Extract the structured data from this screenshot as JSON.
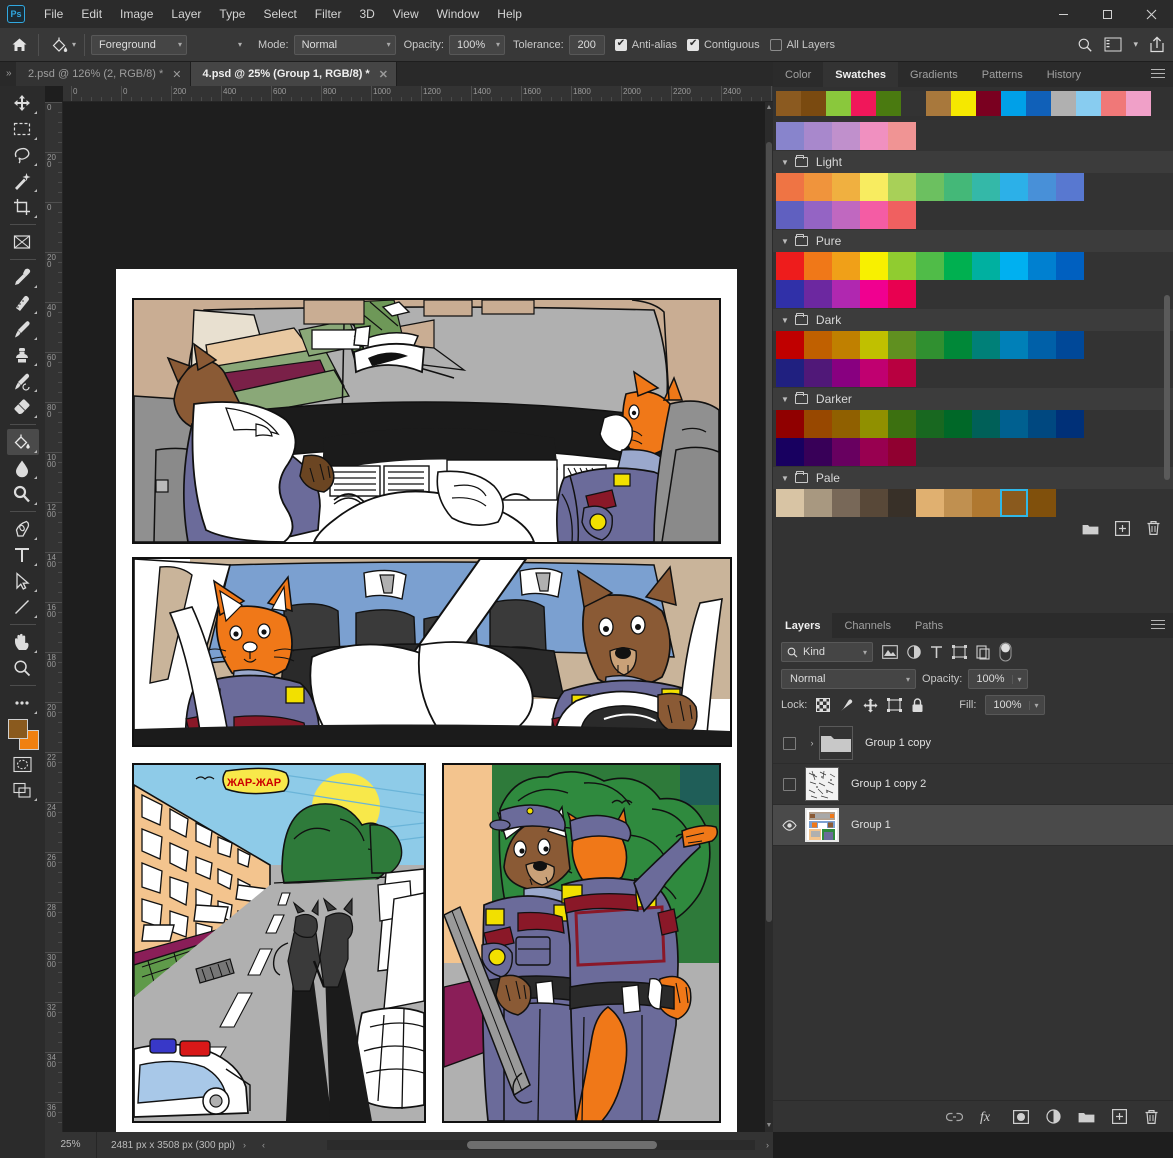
{
  "app": {
    "logo": "Ps",
    "menu": [
      "File",
      "Edit",
      "Image",
      "Layer",
      "Type",
      "Select",
      "Filter",
      "3D",
      "View",
      "Window",
      "Help"
    ],
    "window_controls": [
      "minimize",
      "maximize",
      "close"
    ]
  },
  "options_bar": {
    "home_icon": "home-icon",
    "tool_icon": "paint-bucket-icon",
    "fill_source": "Foreground",
    "mode_label": "Mode:",
    "mode_value": "Normal",
    "opacity_label": "Opacity:",
    "opacity_value": "100%",
    "tolerance_label": "Tolerance:",
    "tolerance_value": "200",
    "antialias_label": "Anti-alias",
    "antialias_checked": true,
    "contiguous_label": "Contiguous",
    "contiguous_checked": true,
    "all_layers_label": "All Layers",
    "all_layers_checked": false,
    "right_icons": [
      "search-icon",
      "workspace-icon",
      "chevron-down-icon",
      "share-icon"
    ]
  },
  "tabs": {
    "overflow_left": "»",
    "items": [
      {
        "label": "2.psd @ 126% (2, RGB/8) *",
        "active": false
      },
      {
        "label": "4.psd @ 25% (Group 1, RGB/8) *",
        "active": true
      }
    ],
    "overflow_right": "»"
  },
  "toolbar": {
    "tools": [
      {
        "name": "move-tool",
        "glyph": "move",
        "selected": false,
        "has_flyout": true
      },
      {
        "name": "rectangular-marquee-tool",
        "glyph": "marquee",
        "selected": false,
        "has_flyout": true
      },
      {
        "name": "lasso-tool",
        "glyph": "lasso",
        "selected": false,
        "has_flyout": true
      },
      {
        "name": "magic-wand-tool",
        "glyph": "wand",
        "selected": false,
        "has_flyout": true
      },
      {
        "name": "crop-tool",
        "glyph": "crop",
        "selected": false,
        "has_flyout": true
      },
      {
        "name": "frame-tool",
        "glyph": "frame",
        "selected": false,
        "has_flyout": false
      },
      {
        "name": "eyedropper-tool",
        "glyph": "eyedropper",
        "selected": false,
        "has_flyout": true
      },
      {
        "name": "spot-healing-brush-tool",
        "glyph": "heal",
        "selected": false,
        "has_flyout": true
      },
      {
        "name": "brush-tool",
        "glyph": "brush",
        "selected": false,
        "has_flyout": true
      },
      {
        "name": "clone-stamp-tool",
        "glyph": "stamp",
        "selected": false,
        "has_flyout": true
      },
      {
        "name": "history-brush-tool",
        "glyph": "historybrush",
        "selected": false,
        "has_flyout": true
      },
      {
        "name": "eraser-tool",
        "glyph": "eraser",
        "selected": false,
        "has_flyout": true
      },
      {
        "name": "paint-bucket-tool",
        "glyph": "bucket",
        "selected": true,
        "has_flyout": true
      },
      {
        "name": "blur-tool",
        "glyph": "blur",
        "selected": false,
        "has_flyout": true
      },
      {
        "name": "dodge-tool",
        "glyph": "dodge",
        "selected": false,
        "has_flyout": true
      },
      {
        "name": "pen-tool",
        "glyph": "pen",
        "selected": false,
        "has_flyout": true
      },
      {
        "name": "horizontal-type-tool",
        "glyph": "type",
        "selected": false,
        "has_flyout": true
      },
      {
        "name": "path-selection-tool",
        "glyph": "pathselect",
        "selected": false,
        "has_flyout": true
      },
      {
        "name": "line-tool",
        "glyph": "line",
        "selected": false,
        "has_flyout": true
      },
      {
        "name": "hand-tool",
        "glyph": "hand",
        "selected": false,
        "has_flyout": true
      },
      {
        "name": "zoom-tool",
        "glyph": "zoom",
        "selected": false,
        "has_flyout": false
      },
      {
        "name": "edit-toolbar-button",
        "glyph": "ellipsis",
        "selected": false,
        "has_flyout": true
      }
    ],
    "foreground_color": "#8a5a1e",
    "background_color": "#f08010",
    "quickmask_icon": "quick-mask-icon",
    "screenmode_icon": "screen-mode-icon"
  },
  "ruler": {
    "horizontal_labels": [
      "0",
      "0",
      "200",
      "400",
      "600",
      "800",
      "1000",
      "1200",
      "1400",
      "1600",
      "1800",
      "2000",
      "2200",
      "2400",
      "2"
    ],
    "vertical_labels": [
      "0",
      "200",
      "0",
      "200",
      "400",
      "600",
      "800",
      "1000",
      "1200",
      "1400",
      "1600",
      "1800",
      "2000",
      "2200",
      "2400",
      "2600",
      "2800",
      "3000",
      "3200",
      "3400",
      "3600"
    ]
  },
  "swatches_panel": {
    "tabs": [
      {
        "label": "Color",
        "active": false
      },
      {
        "label": "Swatches",
        "active": true
      },
      {
        "label": "Gradients",
        "active": false
      },
      {
        "label": "Patterns",
        "active": false
      },
      {
        "label": "History",
        "active": false
      }
    ],
    "recent": [
      "#8b5a20",
      "#7a4a10",
      "#8ac83c",
      "#f0175a",
      "#4a7a10",
      "#333333",
      "#a8783c",
      "#f5e800",
      "#7a0020",
      "#00a0e8",
      "#1060b8",
      "#b0b0b0",
      "#88ccf0",
      "#f07878",
      "#f0a0c8"
    ],
    "scroll_top_partial": [
      "#8884cc",
      "#a888cc",
      "#c090cc",
      "#f090c0",
      "#f09494"
    ],
    "groups": [
      {
        "name": "Light",
        "rows": [
          [
            "#ef7444",
            "#f0943c",
            "#f0b040",
            "#f8ec60",
            "#a8d058",
            "#6cc060",
            "#44b878",
            "#34b8a8",
            "#2cb0e8",
            "#4890d8",
            "#5878d0"
          ],
          [
            "#6060c0",
            "#9464c4",
            "#c068c0",
            "#f45ca4",
            "#f06060"
          ]
        ]
      },
      {
        "name": "Pure",
        "rows": [
          [
            "#ee1c1c",
            "#f07818",
            "#f0a018",
            "#f8f000",
            "#90cc30",
            "#50bc48",
            "#00b050",
            "#00b0a0",
            "#00b0f0",
            "#0080d0",
            "#0060c0"
          ],
          [
            "#3030a8",
            "#6c28a0",
            "#b028b0",
            "#f00090",
            "#e80050"
          ]
        ]
      },
      {
        "name": "Dark",
        "rows": [
          [
            "#c00000",
            "#c06000",
            "#c08000",
            "#c0c000",
            "#609020",
            "#309030",
            "#008838",
            "#008078",
            "#0080b8",
            "#0060a8",
            "#004898"
          ],
          [
            "#202080",
            "#501878",
            "#880080",
            "#c00070",
            "#b80040"
          ]
        ]
      },
      {
        "name": "Darker",
        "rows": [
          [
            "#900000",
            "#984800",
            "#906000",
            "#909000",
            "#3c7010",
            "#186820",
            "#006828",
            "#006058",
            "#006090",
            "#004880",
            "#003078"
          ],
          [
            "#180060",
            "#380058",
            "#680060",
            "#980050",
            "#900030"
          ]
        ]
      },
      {
        "name": "Pale",
        "rows": [
          [
            "#d8c4a4",
            "#a89880",
            "#786858",
            "#584838",
            "#383028",
            "#e0b070",
            "#c09050",
            "#b07830",
            "#8a5a1e",
            "#80500c"
          ]
        ]
      }
    ],
    "selected_swatch": "#8a5a1e",
    "footer_icons": [
      "new-group-icon",
      "new-swatch-icon",
      "delete-swatch-icon"
    ]
  },
  "layers_panel": {
    "tabs": [
      {
        "label": "Layers",
        "active": true
      },
      {
        "label": "Channels",
        "active": false
      },
      {
        "label": "Paths",
        "active": false
      }
    ],
    "filter_kind": "Kind",
    "filter_icons": [
      "pixel-filter-icon",
      "adjustment-filter-icon",
      "type-filter-icon",
      "shape-filter-icon",
      "smartobject-filter-icon"
    ],
    "filter_toggle": "filter-toggle-icon",
    "blend_mode": "Normal",
    "opacity_label": "Opacity:",
    "opacity_value": "100%",
    "lock_label": "Lock:",
    "lock_icons": [
      "lock-transparent-pixels-icon",
      "lock-image-pixels-icon",
      "lock-position-icon",
      "lock-artboard-icon",
      "lock-all-icon"
    ],
    "fill_label": "Fill:",
    "fill_value": "100%",
    "layers": [
      {
        "name": "Group 1 copy",
        "visible": false,
        "is_group": true,
        "selected": false,
        "thumb": "folder"
      },
      {
        "name": "Group 1 copy 2",
        "visible": false,
        "is_group": false,
        "selected": false,
        "thumb": "sketch"
      },
      {
        "name": "Group 1",
        "visible": true,
        "is_group": false,
        "selected": true,
        "thumb": "comic"
      }
    ],
    "footer_icons": [
      "link-layers-icon",
      "layer-style-fx-icon",
      "layer-mask-icon",
      "adjustment-layer-icon",
      "new-group-icon",
      "new-layer-icon",
      "delete-layer-icon"
    ]
  },
  "status_bar": {
    "zoom": "25%",
    "doc_info": "2481 px x 3508 px (300 ppi)",
    "expand_arrow": "›",
    "left_arrow": "‹",
    "right_arrow": "›"
  },
  "artwork": {
    "title": "Police comic page",
    "panels": [
      {
        "name": "panel-1-car-interior",
        "caption": "Two officers inside a patrol car, dashboard view"
      },
      {
        "name": "panel-2-two-officers-driving",
        "caption": "Cat officer and dog officer in the car, speech bubble"
      },
      {
        "name": "panel-3-street-scene",
        "caption": "City street with shadows, patrol car and sign",
        "sign_text": "ЖАР-ЖАР"
      },
      {
        "name": "panel-4-officers-standing",
        "caption": "Dog and fox officers standing, one pointing"
      }
    ]
  }
}
